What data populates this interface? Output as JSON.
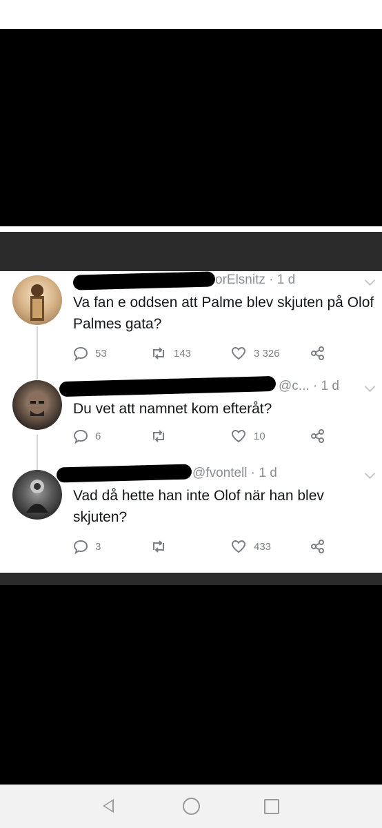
{
  "tweets": [
    {
      "handle": "orElsnitz",
      "time": "· 1 d",
      "text": "Va fan e oddsen att Palme blev skjuten på Olof Palmes gata?",
      "replies": "53",
      "retweets": "143",
      "likes": "3 326"
    },
    {
      "handle": "@c...",
      "time": "· 1 d",
      "text": "Du vet att namnet kom efteråt?",
      "replies": "6",
      "retweets": "",
      "likes": "10"
    },
    {
      "handle": "@fvontell",
      "time": "· 1 d",
      "text": "Vad då hette han inte Olof när han blev skjuten?",
      "replies": "3",
      "retweets": "",
      "likes": "433"
    }
  ],
  "icons": {
    "reply": "reply-icon",
    "retweet": "retweet-icon",
    "like": "heart-icon",
    "share": "share-icon",
    "nav_back": "back-triangle-icon",
    "nav_home": "home-circle-icon",
    "nav_recent": "recents-square-icon"
  },
  "colors": {
    "text": "#14171a",
    "meta": "#8a8f95",
    "background_frame": "#000000",
    "band": "#2b2b2b"
  }
}
